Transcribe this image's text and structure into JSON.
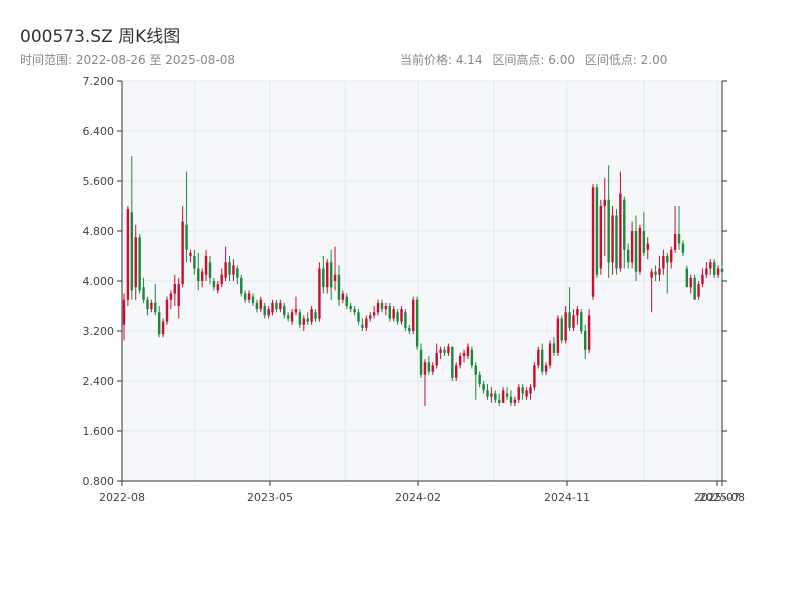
{
  "header": {
    "title": "000573.SZ 周K线图",
    "subtitle_prefix": "时间范围: ",
    "range_start": "2022-08-26",
    "range_sep": " 至 ",
    "range_end": "2025-08-08",
    "current_price": "当前价格: 4.14",
    "range_high": "区间高点: 6.00",
    "range_low": "区间低点: 2.00"
  },
  "colors": {
    "up": "#c8102e",
    "down": "#1a8a3a",
    "plot_bg": "#f5f7fa",
    "grid": "#e4e7ec",
    "axis": "#333333"
  },
  "chart_data": {
    "type": "candlestick",
    "ylim": [
      0.8,
      7.2
    ],
    "yticks": [
      "0.800",
      "1.600",
      "2.400",
      "3.200",
      "4.000",
      "4.800",
      "5.600",
      "6.400",
      "7.200"
    ],
    "xticks": [
      "2022-08",
      "2023-05",
      "2024-02",
      "2024-11",
      "2025-07",
      "2025-08"
    ],
    "candles": [
      [
        3.3,
        3.8,
        3.05,
        3.7
      ],
      [
        3.7,
        5.2,
        3.6,
        5.15
      ],
      [
        5.1,
        6.0,
        3.7,
        3.85
      ],
      [
        3.9,
        4.9,
        3.7,
        4.7
      ],
      [
        4.7,
        4.75,
        3.8,
        3.85
      ],
      [
        3.9,
        4.05,
        3.65,
        3.7
      ],
      [
        3.7,
        3.75,
        3.45,
        3.55
      ],
      [
        3.55,
        3.7,
        3.5,
        3.65
      ],
      [
        3.65,
        3.95,
        3.45,
        3.5
      ],
      [
        3.5,
        3.6,
        3.1,
        3.15
      ],
      [
        3.15,
        3.4,
        3.1,
        3.35
      ],
      [
        3.35,
        3.75,
        3.3,
        3.7
      ],
      [
        3.7,
        3.85,
        3.55,
        3.8
      ],
      [
        3.8,
        4.1,
        3.6,
        3.95
      ],
      [
        3.6,
        4.05,
        3.4,
        3.95
      ],
      [
        3.95,
        5.2,
        3.9,
        4.95
      ],
      [
        4.9,
        5.75,
        4.3,
        4.5
      ],
      [
        4.4,
        4.5,
        4.3,
        4.45
      ],
      [
        4.4,
        4.5,
        4.1,
        4.2
      ],
      [
        4.2,
        4.45,
        3.85,
        4.0
      ],
      [
        4.0,
        4.2,
        3.9,
        4.15
      ],
      [
        4.1,
        4.5,
        4.0,
        4.4
      ],
      [
        4.3,
        4.4,
        3.95,
        4.05
      ],
      [
        4.0,
        4.05,
        3.85,
        3.9
      ],
      [
        3.85,
        4.0,
        3.8,
        3.95
      ],
      [
        3.95,
        4.2,
        3.9,
        4.1
      ],
      [
        4.05,
        4.55,
        4.0,
        4.3
      ],
      [
        4.3,
        4.4,
        4.0,
        4.1
      ],
      [
        4.1,
        4.35,
        4.0,
        4.25
      ],
      [
        4.2,
        4.25,
        3.95,
        4.05
      ],
      [
        4.05,
        4.1,
        3.75,
        3.8
      ],
      [
        3.8,
        3.85,
        3.65,
        3.7
      ],
      [
        3.7,
        3.85,
        3.65,
        3.8
      ],
      [
        3.75,
        3.8,
        3.6,
        3.65
      ],
      [
        3.65,
        3.7,
        3.5,
        3.55
      ],
      [
        3.55,
        3.75,
        3.5,
        3.7
      ],
      [
        3.6,
        3.65,
        3.4,
        3.45
      ],
      [
        3.45,
        3.6,
        3.4,
        3.55
      ],
      [
        3.5,
        3.7,
        3.45,
        3.65
      ],
      [
        3.65,
        3.7,
        3.5,
        3.55
      ],
      [
        3.55,
        3.7,
        3.5,
        3.65
      ],
      [
        3.6,
        3.65,
        3.4,
        3.45
      ],
      [
        3.45,
        3.5,
        3.35,
        3.4
      ],
      [
        3.35,
        3.55,
        3.3,
        3.5
      ],
      [
        3.5,
        3.75,
        3.45,
        3.55
      ],
      [
        3.5,
        3.55,
        3.25,
        3.3
      ],
      [
        3.3,
        3.45,
        3.2,
        3.4
      ],
      [
        3.4,
        3.5,
        3.3,
        3.35
      ],
      [
        3.35,
        3.6,
        3.3,
        3.55
      ],
      [
        3.5,
        3.55,
        3.35,
        3.4
      ],
      [
        3.4,
        4.3,
        3.35,
        4.2
      ],
      [
        4.2,
        4.4,
        3.8,
        3.9
      ],
      [
        3.9,
        4.35,
        3.8,
        4.3
      ],
      [
        4.3,
        4.5,
        3.7,
        3.9
      ],
      [
        4.0,
        4.55,
        3.85,
        4.1
      ],
      [
        4.1,
        4.25,
        3.6,
        3.7
      ],
      [
        3.7,
        3.85,
        3.65,
        3.8
      ],
      [
        3.75,
        3.8,
        3.55,
        3.6
      ],
      [
        3.6,
        3.65,
        3.5,
        3.55
      ],
      [
        3.55,
        3.6,
        3.45,
        3.5
      ],
      [
        3.5,
        3.55,
        3.3,
        3.35
      ],
      [
        3.3,
        3.4,
        3.2,
        3.25
      ],
      [
        3.25,
        3.45,
        3.2,
        3.4
      ],
      [
        3.4,
        3.5,
        3.35,
        3.45
      ],
      [
        3.45,
        3.6,
        3.4,
        3.5
      ],
      [
        3.5,
        3.7,
        3.45,
        3.65
      ],
      [
        3.65,
        3.7,
        3.5,
        3.55
      ],
      [
        3.55,
        3.65,
        3.45,
        3.6
      ],
      [
        3.6,
        3.65,
        3.35,
        3.4
      ],
      [
        3.4,
        3.6,
        3.35,
        3.55
      ],
      [
        3.5,
        3.55,
        3.3,
        3.35
      ],
      [
        3.35,
        3.6,
        3.3,
        3.55
      ],
      [
        3.5,
        3.55,
        3.2,
        3.25
      ],
      [
        3.25,
        3.3,
        3.15,
        3.2
      ],
      [
        3.2,
        3.75,
        3.15,
        3.7
      ],
      [
        3.7,
        3.75,
        2.9,
        2.95
      ],
      [
        2.9,
        3.0,
        2.45,
        2.5
      ],
      [
        2.5,
        2.75,
        2.0,
        2.7
      ],
      [
        2.7,
        2.8,
        2.5,
        2.55
      ],
      [
        2.55,
        2.7,
        2.5,
        2.65
      ],
      [
        2.65,
        3.0,
        2.6,
        2.85
      ],
      [
        2.85,
        2.95,
        2.75,
        2.9
      ],
      [
        2.9,
        2.95,
        2.8,
        2.85
      ],
      [
        2.85,
        3.0,
        2.8,
        2.95
      ],
      [
        2.95,
        2.95,
        2.4,
        2.45
      ],
      [
        2.45,
        2.7,
        2.4,
        2.65
      ],
      [
        2.65,
        2.85,
        2.6,
        2.8
      ],
      [
        2.8,
        2.9,
        2.7,
        2.85
      ],
      [
        2.8,
        3.0,
        2.75,
        2.95
      ],
      [
        2.9,
        2.95,
        2.6,
        2.65
      ],
      [
        2.65,
        2.7,
        2.1,
        2.5
      ],
      [
        2.5,
        2.55,
        2.3,
        2.35
      ],
      [
        2.35,
        2.4,
        2.2,
        2.25
      ],
      [
        2.25,
        2.35,
        2.1,
        2.15
      ],
      [
        2.15,
        2.3,
        2.05,
        2.2
      ],
      [
        2.2,
        2.25,
        2.05,
        2.1
      ],
      [
        2.1,
        2.2,
        2.0,
        2.05
      ],
      [
        2.05,
        2.3,
        2.05,
        2.25
      ],
      [
        2.2,
        2.3,
        2.1,
        2.15
      ],
      [
        2.15,
        2.25,
        2.0,
        2.05
      ],
      [
        2.05,
        2.15,
        2.0,
        2.1
      ],
      [
        2.1,
        2.35,
        2.05,
        2.3
      ],
      [
        2.3,
        2.35,
        2.1,
        2.2
      ],
      [
        2.15,
        2.3,
        2.1,
        2.25
      ],
      [
        2.2,
        2.35,
        2.1,
        2.3
      ],
      [
        2.3,
        2.7,
        2.25,
        2.65
      ],
      [
        2.65,
        2.95,
        2.6,
        2.9
      ],
      [
        2.9,
        3.0,
        2.5,
        2.55
      ],
      [
        2.55,
        2.7,
        2.5,
        2.65
      ],
      [
        2.65,
        3.05,
        2.6,
        3.0
      ],
      [
        3.0,
        3.1,
        2.8,
        2.85
      ],
      [
        2.85,
        3.45,
        2.8,
        3.4
      ],
      [
        3.4,
        3.45,
        3.0,
        3.05
      ],
      [
        3.05,
        3.6,
        3.0,
        3.5
      ],
      [
        3.5,
        3.9,
        3.2,
        3.25
      ],
      [
        3.25,
        3.55,
        3.2,
        3.45
      ],
      [
        3.45,
        3.6,
        3.3,
        3.55
      ],
      [
        3.5,
        3.55,
        3.15,
        3.2
      ],
      [
        3.2,
        3.3,
        2.75,
        2.9
      ],
      [
        2.9,
        3.55,
        2.85,
        3.45
      ],
      [
        3.75,
        5.55,
        3.7,
        5.5
      ],
      [
        5.5,
        5.55,
        4.05,
        4.1
      ],
      [
        4.2,
        5.3,
        4.1,
        5.2
      ],
      [
        5.2,
        5.65,
        4.4,
        5.3
      ],
      [
        5.3,
        5.85,
        4.05,
        4.3
      ],
      [
        4.3,
        5.2,
        4.1,
        5.05
      ],
      [
        5.05,
        5.15,
        4.1,
        4.2
      ],
      [
        4.2,
        5.75,
        4.15,
        5.4
      ],
      [
        5.3,
        5.35,
        4.2,
        4.5
      ],
      [
        4.5,
        4.6,
        4.2,
        4.3
      ],
      [
        4.3,
        4.95,
        4.2,
        4.8
      ],
      [
        4.8,
        5.05,
        4.0,
        4.15
      ],
      [
        4.15,
        4.9,
        4.1,
        4.85
      ],
      [
        4.8,
        5.1,
        4.4,
        4.45
      ],
      [
        4.5,
        4.7,
        4.35,
        4.6
      ],
      [
        4.05,
        4.2,
        3.5,
        4.15
      ],
      [
        4.15,
        4.25,
        4.0,
        4.1
      ],
      [
        4.1,
        4.4,
        4.0,
        4.2
      ],
      [
        4.2,
        4.5,
        4.1,
        4.4
      ],
      [
        4.4,
        4.45,
        3.8,
        4.3
      ],
      [
        4.3,
        4.55,
        4.2,
        4.5
      ],
      [
        4.5,
        5.2,
        4.45,
        4.75
      ],
      [
        4.75,
        5.2,
        4.5,
        4.6
      ],
      [
        4.6,
        4.65,
        4.4,
        4.45
      ],
      [
        4.2,
        4.25,
        3.95,
        3.9
      ],
      [
        3.9,
        4.1,
        3.8,
        4.05
      ],
      [
        4.05,
        4.1,
        3.85,
        3.7
      ],
      [
        3.75,
        4.0,
        3.7,
        3.95
      ],
      [
        3.95,
        4.2,
        3.9,
        4.1
      ],
      [
        4.1,
        4.3,
        4.05,
        4.2
      ],
      [
        4.2,
        4.35,
        4.1,
        4.3
      ],
      [
        4.3,
        4.35,
        4.05,
        4.1
      ],
      [
        4.1,
        4.25,
        4.05,
        4.2
      ],
      [
        4.2,
        4.25,
        4.05,
        4.14
      ]
    ]
  }
}
